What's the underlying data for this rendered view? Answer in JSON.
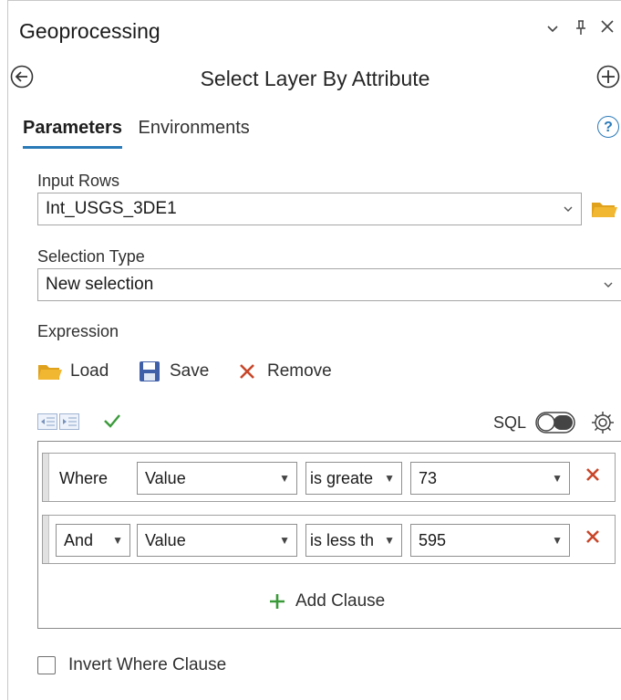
{
  "header": {
    "title": "Geoprocessing",
    "menu_chevron": "⌄",
    "pin_glyph": "⊥",
    "close_glyph": "×"
  },
  "tool": {
    "title": "Select Layer By Attribute",
    "back_icon": "back-circle-icon",
    "add_icon": "add-circle-icon"
  },
  "tabs": [
    {
      "label": "Parameters",
      "active": true
    },
    {
      "label": "Environments",
      "active": false
    }
  ],
  "help_label": "?",
  "params": {
    "input_rows": {
      "label": "Input Rows",
      "value": "Int_USGS_3DE1"
    },
    "selection_type": {
      "label": "Selection Type",
      "value": "New selection"
    },
    "expression": {
      "label": "Expression"
    }
  },
  "expression_actions": {
    "load": "Load",
    "save": "Save",
    "remove": "Remove"
  },
  "sql_label": "SQL",
  "clauses": [
    {
      "connector": "Where",
      "field": "Value",
      "operator": "is greate",
      "value": "73"
    },
    {
      "connector": "And",
      "field": "Value",
      "operator": "is less th",
      "value": "595"
    }
  ],
  "add_clause_label": "Add Clause",
  "invert_where_label": "Invert Where Clause",
  "colors": {
    "accent_blue": "#2a7ab8",
    "remove_red": "#c8462a",
    "folder_yellow": "#f2b731",
    "add_green": "#3a9a3a"
  }
}
